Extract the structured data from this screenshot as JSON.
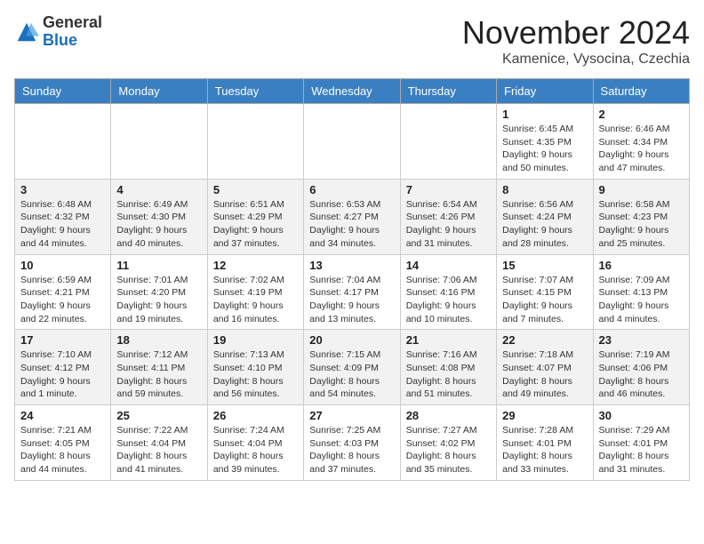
{
  "logo": {
    "general": "General",
    "blue": "Blue"
  },
  "header": {
    "month": "November 2024",
    "location": "Kamenice, Vysocina, Czechia"
  },
  "weekdays": [
    "Sunday",
    "Monday",
    "Tuesday",
    "Wednesday",
    "Thursday",
    "Friday",
    "Saturday"
  ],
  "weeks": [
    [
      {
        "day": "",
        "info": ""
      },
      {
        "day": "",
        "info": ""
      },
      {
        "day": "",
        "info": ""
      },
      {
        "day": "",
        "info": ""
      },
      {
        "day": "",
        "info": ""
      },
      {
        "day": "1",
        "info": "Sunrise: 6:45 AM\nSunset: 4:35 PM\nDaylight: 9 hours and 50 minutes."
      },
      {
        "day": "2",
        "info": "Sunrise: 6:46 AM\nSunset: 4:34 PM\nDaylight: 9 hours and 47 minutes."
      }
    ],
    [
      {
        "day": "3",
        "info": "Sunrise: 6:48 AM\nSunset: 4:32 PM\nDaylight: 9 hours and 44 minutes."
      },
      {
        "day": "4",
        "info": "Sunrise: 6:49 AM\nSunset: 4:30 PM\nDaylight: 9 hours and 40 minutes."
      },
      {
        "day": "5",
        "info": "Sunrise: 6:51 AM\nSunset: 4:29 PM\nDaylight: 9 hours and 37 minutes."
      },
      {
        "day": "6",
        "info": "Sunrise: 6:53 AM\nSunset: 4:27 PM\nDaylight: 9 hours and 34 minutes."
      },
      {
        "day": "7",
        "info": "Sunrise: 6:54 AM\nSunset: 4:26 PM\nDaylight: 9 hours and 31 minutes."
      },
      {
        "day": "8",
        "info": "Sunrise: 6:56 AM\nSunset: 4:24 PM\nDaylight: 9 hours and 28 minutes."
      },
      {
        "day": "9",
        "info": "Sunrise: 6:58 AM\nSunset: 4:23 PM\nDaylight: 9 hours and 25 minutes."
      }
    ],
    [
      {
        "day": "10",
        "info": "Sunrise: 6:59 AM\nSunset: 4:21 PM\nDaylight: 9 hours and 22 minutes."
      },
      {
        "day": "11",
        "info": "Sunrise: 7:01 AM\nSunset: 4:20 PM\nDaylight: 9 hours and 19 minutes."
      },
      {
        "day": "12",
        "info": "Sunrise: 7:02 AM\nSunset: 4:19 PM\nDaylight: 9 hours and 16 minutes."
      },
      {
        "day": "13",
        "info": "Sunrise: 7:04 AM\nSunset: 4:17 PM\nDaylight: 9 hours and 13 minutes."
      },
      {
        "day": "14",
        "info": "Sunrise: 7:06 AM\nSunset: 4:16 PM\nDaylight: 9 hours and 10 minutes."
      },
      {
        "day": "15",
        "info": "Sunrise: 7:07 AM\nSunset: 4:15 PM\nDaylight: 9 hours and 7 minutes."
      },
      {
        "day": "16",
        "info": "Sunrise: 7:09 AM\nSunset: 4:13 PM\nDaylight: 9 hours and 4 minutes."
      }
    ],
    [
      {
        "day": "17",
        "info": "Sunrise: 7:10 AM\nSunset: 4:12 PM\nDaylight: 9 hours and 1 minute."
      },
      {
        "day": "18",
        "info": "Sunrise: 7:12 AM\nSunset: 4:11 PM\nDaylight: 8 hours and 59 minutes."
      },
      {
        "day": "19",
        "info": "Sunrise: 7:13 AM\nSunset: 4:10 PM\nDaylight: 8 hours and 56 minutes."
      },
      {
        "day": "20",
        "info": "Sunrise: 7:15 AM\nSunset: 4:09 PM\nDaylight: 8 hours and 54 minutes."
      },
      {
        "day": "21",
        "info": "Sunrise: 7:16 AM\nSunset: 4:08 PM\nDaylight: 8 hours and 51 minutes."
      },
      {
        "day": "22",
        "info": "Sunrise: 7:18 AM\nSunset: 4:07 PM\nDaylight: 8 hours and 49 minutes."
      },
      {
        "day": "23",
        "info": "Sunrise: 7:19 AM\nSunset: 4:06 PM\nDaylight: 8 hours and 46 minutes."
      }
    ],
    [
      {
        "day": "24",
        "info": "Sunrise: 7:21 AM\nSunset: 4:05 PM\nDaylight: 8 hours and 44 minutes."
      },
      {
        "day": "25",
        "info": "Sunrise: 7:22 AM\nSunset: 4:04 PM\nDaylight: 8 hours and 41 minutes."
      },
      {
        "day": "26",
        "info": "Sunrise: 7:24 AM\nSunset: 4:04 PM\nDaylight: 8 hours and 39 minutes."
      },
      {
        "day": "27",
        "info": "Sunrise: 7:25 AM\nSunset: 4:03 PM\nDaylight: 8 hours and 37 minutes."
      },
      {
        "day": "28",
        "info": "Sunrise: 7:27 AM\nSunset: 4:02 PM\nDaylight: 8 hours and 35 minutes."
      },
      {
        "day": "29",
        "info": "Sunrise: 7:28 AM\nSunset: 4:01 PM\nDaylight: 8 hours and 33 minutes."
      },
      {
        "day": "30",
        "info": "Sunrise: 7:29 AM\nSunset: 4:01 PM\nDaylight: 8 hours and 31 minutes."
      }
    ]
  ]
}
